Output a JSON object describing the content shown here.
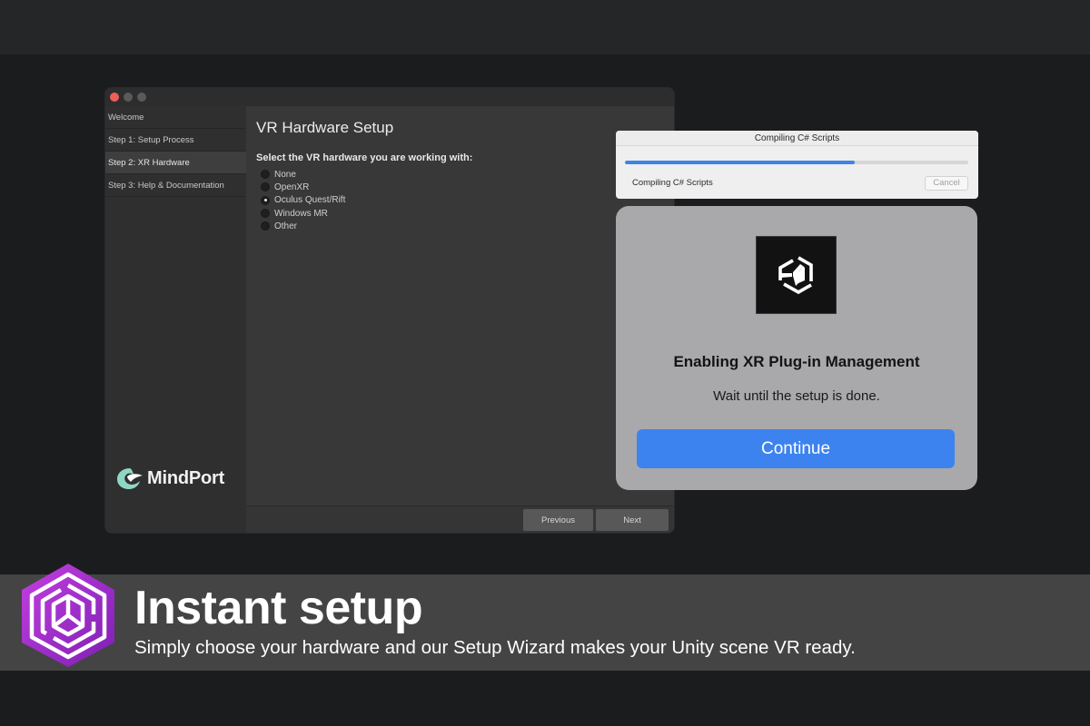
{
  "wizard": {
    "title": "VR Hardware Setup",
    "prompt": "Select the VR hardware you are working with:",
    "sidebar": [
      {
        "label": "Welcome"
      },
      {
        "label": "Step 1: Setup Process"
      },
      {
        "label": "Step 2: XR Hardware",
        "active": true
      },
      {
        "label": "Step 3: Help & Documentation"
      }
    ],
    "options": [
      {
        "label": "None",
        "checked": false
      },
      {
        "label": "OpenXR",
        "checked": false
      },
      {
        "label": "Oculus Quest/Rift",
        "checked": true
      },
      {
        "label": "Windows MR",
        "checked": false
      },
      {
        "label": "Other",
        "checked": false
      }
    ],
    "logo_text": "MindPort",
    "previous_label": "Previous",
    "next_label": "Next"
  },
  "compile": {
    "title": "Compiling C# Scripts",
    "label": "Compiling C# Scripts",
    "cancel_label": "Cancel",
    "progress": 0.67
  },
  "dialog": {
    "title": "Enabling XR Plug-in Management",
    "message": "Wait until the setup is done.",
    "button_label": "Continue",
    "icon": "unity-logo-icon"
  },
  "banner": {
    "title": "Instant setup",
    "subtitle": "Simply choose your hardware and our Setup Wizard makes your Unity scene VR ready.",
    "icon": "hexagon-cube-logo-icon"
  },
  "colors": {
    "accent_blue": "#3d83f0",
    "brand_purple": "#9b2fc9",
    "close_red": "#ec5f57"
  }
}
